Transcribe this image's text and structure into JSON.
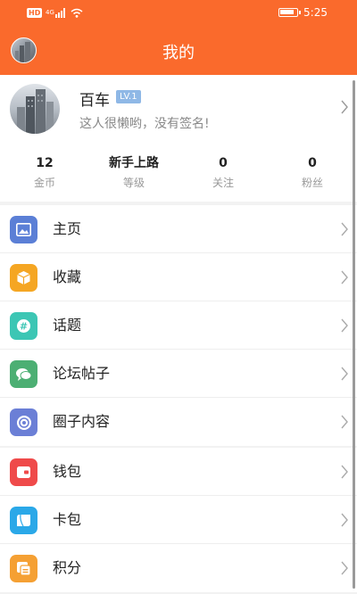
{
  "status_bar": {
    "left_text": "4G",
    "time": "5:25"
  },
  "nav": {
    "title": "我的"
  },
  "profile": {
    "username": "百车",
    "level": "LV.1",
    "signature": "这人很懒哟，没有签名!"
  },
  "stats": [
    {
      "value": "12",
      "label": "金币"
    },
    {
      "value": "新手上路",
      "label": "等级"
    },
    {
      "value": "0",
      "label": "关注"
    },
    {
      "value": "0",
      "label": "粉丝"
    }
  ],
  "menu_group_1": [
    {
      "label": "主页",
      "icon": "image-icon",
      "color": "#5b7fd6"
    },
    {
      "label": "收藏",
      "icon": "box-icon",
      "color": "#f5a623"
    },
    {
      "label": "话题",
      "icon": "hashtag-icon",
      "color": "#3cc6b4"
    },
    {
      "label": "论坛帖子",
      "icon": "chat-icon",
      "color": "#4caf73"
    },
    {
      "label": "圈子内容",
      "icon": "circle-icon",
      "color": "#6b7fd6"
    }
  ],
  "menu_group_2": [
    {
      "label": "钱包",
      "icon": "wallet-icon",
      "color": "#ef4a4a"
    },
    {
      "label": "卡包",
      "icon": "card-icon",
      "color": "#2aa8e8"
    },
    {
      "label": "积分",
      "icon": "points-icon",
      "color": "#f5a033"
    }
  ],
  "colors": {
    "header": "#fa6a2c",
    "level_badge": "#8fb8e6"
  }
}
